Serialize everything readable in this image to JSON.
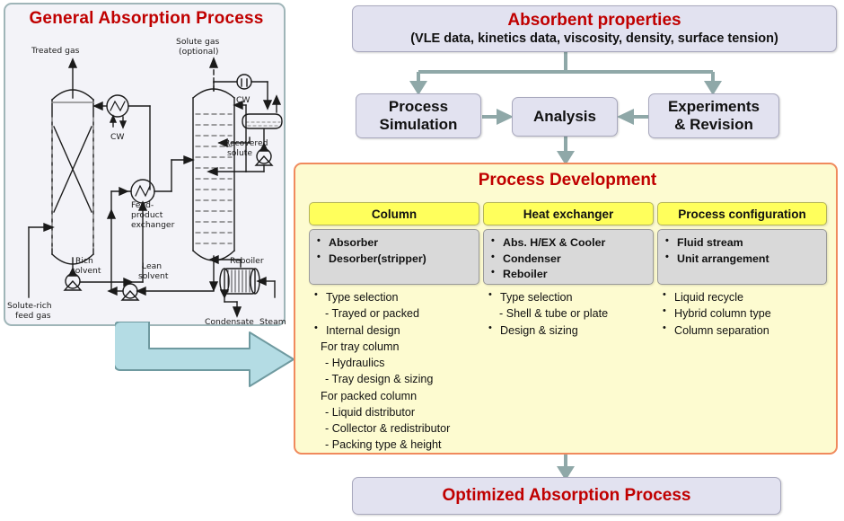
{
  "left_panel": {
    "title": "General Absorption Process",
    "diagram_labels": {
      "treated_gas": "Treated gas",
      "solute_gas": "Solute gas",
      "solute_gas_optional": "(optional)",
      "cw_top_left": "CW",
      "cw_top_right": "CW",
      "feed_product_exchanger_l1": "Feed-",
      "feed_product_exchanger_l2": "product",
      "feed_product_exchanger_l3": "exchanger",
      "rich_solvent_l1": "Rich",
      "rich_solvent_l2": "solvent",
      "lean_solvent_l1": "Lean",
      "lean_solvent_l2": "solvent",
      "recovered_solute_l1": "Recovered",
      "recovered_solute_l2": "solute",
      "reboiler": "Reboiler",
      "condensate": "Condensate",
      "steam": "Steam",
      "solute_rich_feed_gas_l1": "Solute-rich",
      "solute_rich_feed_gas_l2": "feed gas"
    }
  },
  "absorbent_properties": {
    "title": "Absorbent properties",
    "subtitle": "(VLE data, kinetics data, viscosity, density, surface tension)"
  },
  "process_simulation": {
    "line1": "Process",
    "line2": "Simulation"
  },
  "analysis": {
    "label": "Analysis"
  },
  "experiments": {
    "line1": "Experiments",
    "line2": "& Revision"
  },
  "process_development": {
    "title": "Process Development",
    "columns": [
      {
        "header": "Column",
        "items": [
          "Absorber",
          "Desorber(stripper)"
        ],
        "details": [
          {
            "kind": "bullet",
            "text": "Type selection"
          },
          {
            "kind": "dash",
            "text": "- Trayed  or packed"
          },
          {
            "kind": "bullet",
            "text": "Internal design"
          },
          {
            "kind": "plain",
            "text": "For tray column"
          },
          {
            "kind": "dash",
            "text": "- Hydraulics"
          },
          {
            "kind": "dash",
            "text": "- Tray design & sizing"
          },
          {
            "kind": "plain",
            "text": "For packed column"
          },
          {
            "kind": "dash",
            "text": "- Liquid distributor"
          },
          {
            "kind": "dash",
            "text": "- Collector & redistributor"
          },
          {
            "kind": "dash",
            "text": "- Packing type & height"
          }
        ]
      },
      {
        "header": "Heat exchanger",
        "items": [
          "Abs. H/EX & Cooler",
          "Condenser",
          "Reboiler"
        ],
        "details": [
          {
            "kind": "bullet",
            "text": "Type selection"
          },
          {
            "kind": "dash",
            "text": "- Shell & tube or plate"
          },
          {
            "kind": "bullet",
            "text": "Design & sizing"
          }
        ]
      },
      {
        "header": "Process configuration",
        "items": [
          "Fluid stream",
          "Unit arrangement"
        ],
        "details": [
          {
            "kind": "bullet",
            "text": "Liquid recycle"
          },
          {
            "kind": "bullet",
            "text": "Hybrid column type"
          },
          {
            "kind": "bullet",
            "text": "Column separation"
          }
        ]
      }
    ]
  },
  "optimized": {
    "title": "Optimized Absorption Process"
  },
  "colors": {
    "accent_red": "#c00000",
    "box_fill": "#e2e2f0",
    "box_border": "#a8a8bd",
    "arrow": "#8fa8a8",
    "pd_fill": "#fdfbd0",
    "pd_border": "#f08a5d",
    "header_yellow": "#ffff5c",
    "gray_fill": "#d9d9d9",
    "blue_arrow_fill": "#b4dce4",
    "blue_arrow_border": "#6f9aa0",
    "panel_fill": "#f3f3f8",
    "panel_border": "#9fb5b8"
  }
}
